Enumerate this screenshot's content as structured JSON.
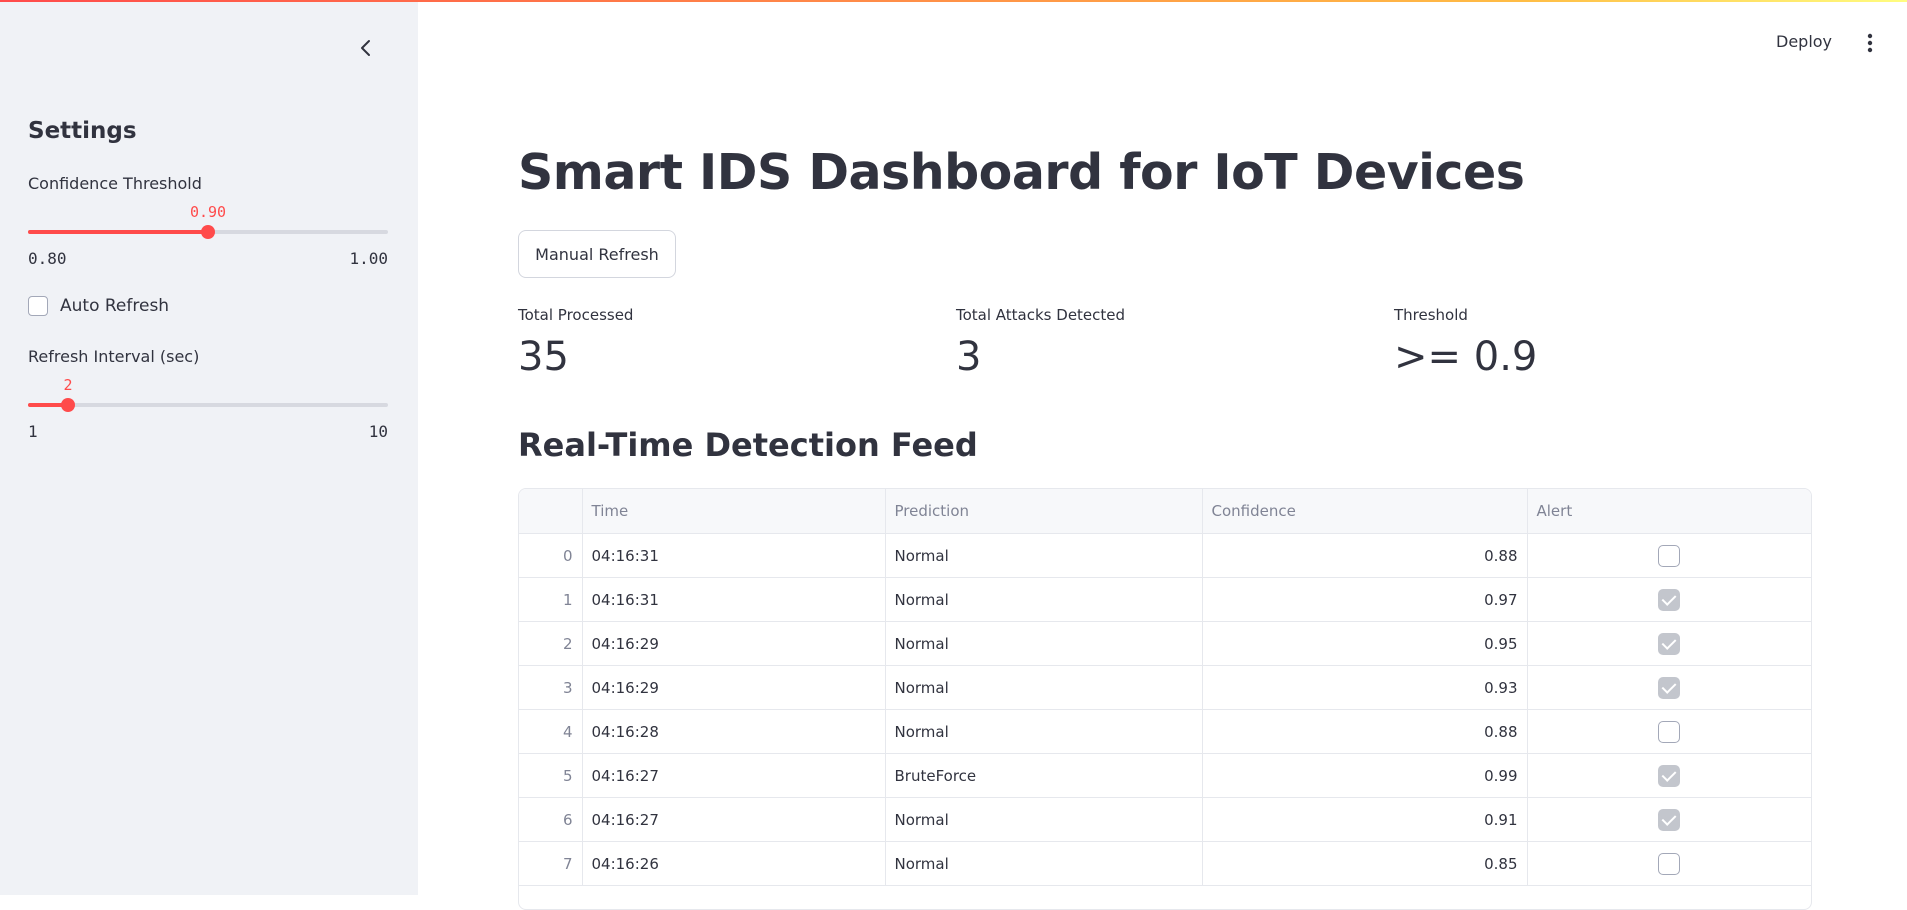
{
  "header": {
    "deploy_label": "Deploy",
    "menu_icon": "kebab-menu-icon"
  },
  "sidebar": {
    "collapse_icon": "chevron-left-icon",
    "heading": "Settings",
    "confidence_slider": {
      "label": "Confidence Threshold",
      "value_label": "0.90",
      "min_label": "0.80",
      "max_label": "1.00",
      "value": 0.9,
      "min": 0.8,
      "max": 1.0
    },
    "auto_refresh": {
      "label": "Auto Refresh",
      "checked": false
    },
    "interval_slider": {
      "label": "Refresh Interval (sec)",
      "value_label": "2",
      "min_label": "1",
      "max_label": "10",
      "value": 2,
      "min": 1,
      "max": 10
    }
  },
  "main": {
    "title": "Smart IDS Dashboard for IoT Devices",
    "refresh_button": "Manual Refresh",
    "metrics": [
      {
        "label": "Total Processed",
        "value": "35"
      },
      {
        "label": "Total Attacks Detected",
        "value": "3"
      },
      {
        "label": "Threshold",
        "value": ">= 0.9"
      }
    ],
    "feed_title": "Real-Time Detection Feed",
    "table": {
      "columns": [
        "",
        "Time",
        "Prediction",
        "Confidence",
        "Alert"
      ],
      "rows": [
        {
          "idx": "0",
          "time": "04:16:31",
          "prediction": "Normal",
          "confidence": "0.88",
          "alert": false
        },
        {
          "idx": "1",
          "time": "04:16:31",
          "prediction": "Normal",
          "confidence": "0.97",
          "alert": true
        },
        {
          "idx": "2",
          "time": "04:16:29",
          "prediction": "Normal",
          "confidence": "0.95",
          "alert": true
        },
        {
          "idx": "3",
          "time": "04:16:29",
          "prediction": "Normal",
          "confidence": "0.93",
          "alert": true
        },
        {
          "idx": "4",
          "time": "04:16:28",
          "prediction": "Normal",
          "confidence": "0.88",
          "alert": false
        },
        {
          "idx": "5",
          "time": "04:16:27",
          "prediction": "BruteForce",
          "confidence": "0.99",
          "alert": true
        },
        {
          "idx": "6",
          "time": "04:16:27",
          "prediction": "Normal",
          "confidence": "0.91",
          "alert": true
        },
        {
          "idx": "7",
          "time": "04:16:26",
          "prediction": "Normal",
          "confidence": "0.85",
          "alert": false
        }
      ]
    }
  },
  "colors": {
    "accent": "#ff4b4b",
    "sidebar_bg": "#f0f2f6",
    "text": "#31333f"
  }
}
